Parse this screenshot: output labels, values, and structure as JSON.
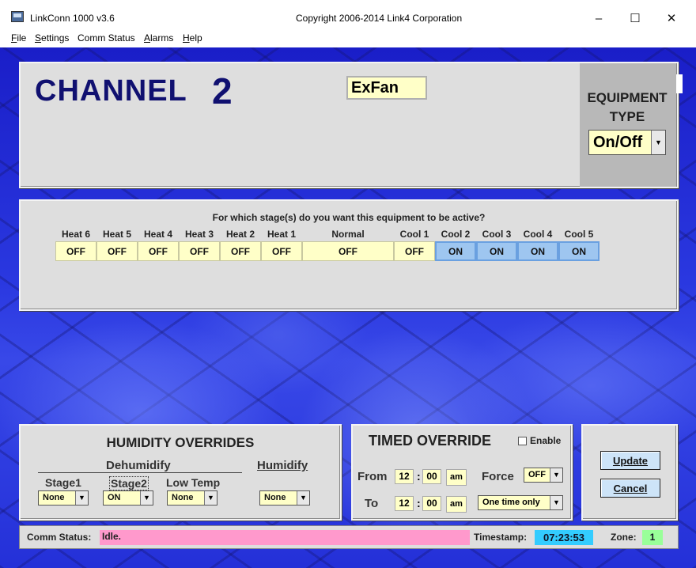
{
  "window": {
    "title": "LinkConn 1000 v3.6",
    "copyright": "Copyright 2006-2014 Link4 Corporation",
    "minimize": "–",
    "maximize": "☐",
    "close": "✕"
  },
  "menu": {
    "file": {
      "accel": "F",
      "rest": "ile"
    },
    "settings": {
      "accel": "S",
      "rest": "ettings"
    },
    "comm_status": "Comm Status",
    "alarms": {
      "accel": "A",
      "rest": "larms"
    },
    "help": {
      "accel": "H",
      "rest": "elp"
    }
  },
  "channel": {
    "label": "CHANNEL",
    "number": "2",
    "name": "ExFan",
    "equipment_type_title": "EQUIPMENT TYPE",
    "equipment_type_value": "On/Off"
  },
  "stages": {
    "question": "For which stage(s) do you want this equipment to be active?",
    "items": [
      {
        "label": "Heat 6",
        "value": "OFF"
      },
      {
        "label": "Heat 5",
        "value": "OFF"
      },
      {
        "label": "Heat 4",
        "value": "OFF"
      },
      {
        "label": "Heat 3",
        "value": "OFF"
      },
      {
        "label": "Heat 2",
        "value": "OFF"
      },
      {
        "label": "Heat 1",
        "value": "OFF"
      },
      {
        "label": "Normal",
        "value": "OFF"
      },
      {
        "label": "Cool 1",
        "value": "OFF"
      },
      {
        "label": "Cool 2",
        "value": "ON"
      },
      {
        "label": "Cool 3",
        "value": "ON"
      },
      {
        "label": "Cool 4",
        "value": "ON"
      },
      {
        "label": "Cool 5",
        "value": "ON"
      }
    ]
  },
  "humidity": {
    "title": "HUMIDITY OVERRIDES",
    "dehumidify_label": "Dehumidify",
    "humidify_label": "Humidify",
    "stage1_label": "Stage1",
    "stage1_value": "None",
    "stage2_label": "Stage2",
    "stage2_value": "ON",
    "lowtemp_label": "Low Temp",
    "lowtemp_value": "None",
    "humidify_value": "None"
  },
  "timed": {
    "title": "TIMED OVERRIDE",
    "enable_label": "Enable",
    "enable_checked": false,
    "from_label": "From",
    "to_label": "To",
    "from_hour": "12",
    "from_min": "00",
    "from_ampm": "am",
    "to_hour": "12",
    "to_min": "00",
    "to_ampm": "am",
    "colon": ":",
    "force_label": "Force",
    "force_value": "OFF",
    "mode_value": "One time only"
  },
  "actions": {
    "update": "Update",
    "cancel": "Cancel"
  },
  "status": {
    "comm_label": "Comm Status:",
    "comm_value": "Idle.",
    "timestamp_label": "Timestamp:",
    "timestamp_value": "07:23:53",
    "zone_label": "Zone:",
    "zone_value": "1"
  },
  "colors": {
    "off_bg": "#ffffc8",
    "on_bg": "#9ec6f0",
    "comm_bg": "#ff99cc",
    "timestamp_bg": "#33ccff",
    "zone_bg": "#99ff99",
    "title_navy": "#101070"
  }
}
